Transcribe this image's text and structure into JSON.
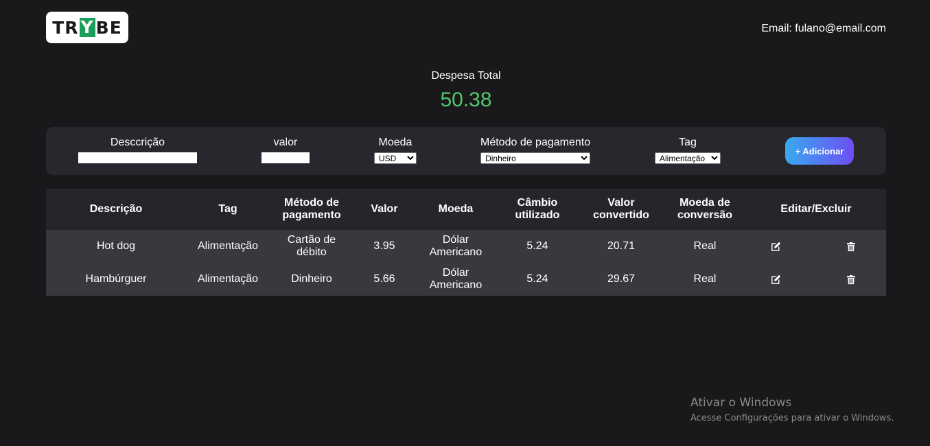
{
  "header": {
    "logo": {
      "part1": "TR",
      "part2": "Y",
      "part3": "BE"
    },
    "email": "Email: fulano@email.com"
  },
  "summary": {
    "label": "Despesa Total",
    "value": "50.38",
    "value_color": "#52c76b"
  },
  "form": {
    "description": {
      "label": "Desccrição",
      "value": ""
    },
    "value": {
      "label": "valor",
      "value": ""
    },
    "currency": {
      "label": "Moeda",
      "selected": "USD"
    },
    "method": {
      "label": "Método de pagamento",
      "selected": "Dinheiro"
    },
    "tag": {
      "label": "Tag",
      "selected": "Alimentação"
    },
    "add_button": "+ Adicionar"
  },
  "table": {
    "headers": {
      "description": "Descrição",
      "tag": "Tag",
      "method": "Método de pagamento",
      "value": "Valor",
      "currency": "Moeda",
      "rate": "Câmbio utilizado",
      "converted": "Valor convertido",
      "conv_currency": "Moeda de conversão",
      "actions": "Editar/Excluir"
    },
    "rows": [
      {
        "description": "Hot dog",
        "tag": "Alimentação",
        "method": "Cartão de débito",
        "value": "3.95",
        "currency": "Dólar Americano",
        "rate": "5.24",
        "converted": "20.71",
        "conv_currency": "Real",
        "edit_icon": "edit-icon",
        "delete_icon": "trash-icon"
      },
      {
        "description": "Hambúrguer",
        "tag": "Alimentação",
        "method": "Dinheiro",
        "value": "5.66",
        "currency": "Dólar Americano",
        "rate": "5.24",
        "converted": "29.67",
        "conv_currency": "Real",
        "edit_icon": "edit-icon",
        "delete_icon": "trash-icon"
      }
    ]
  },
  "watermark": {
    "title": "Ativar o Windows",
    "subtitle": "Acesse Configurações para ativar o Windows."
  }
}
